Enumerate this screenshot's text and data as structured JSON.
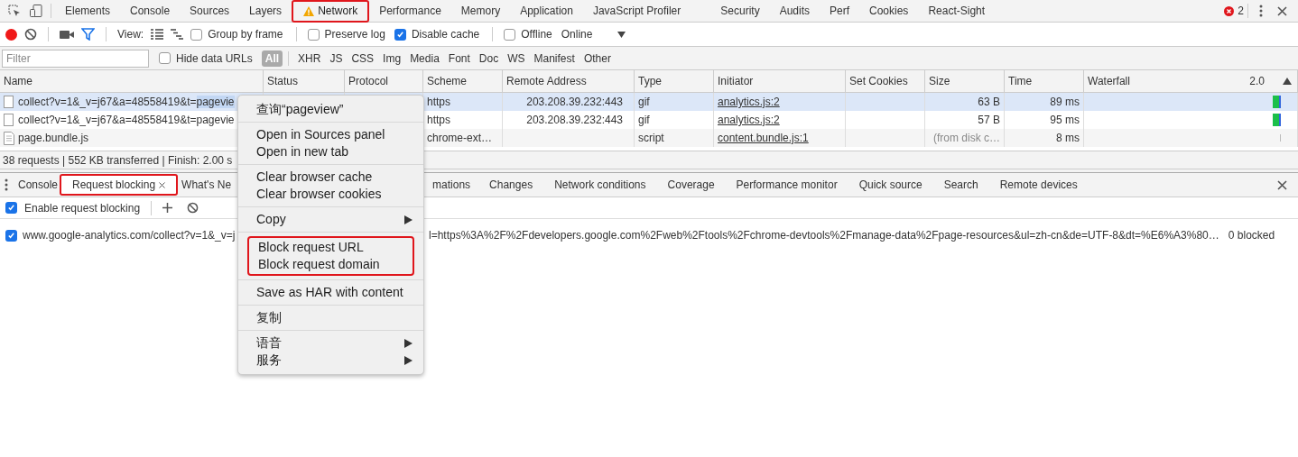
{
  "panel_tabs": [
    {
      "label": "Elements",
      "selected": false,
      "highlighted": false,
      "warning": false
    },
    {
      "label": "Console",
      "selected": false,
      "highlighted": false,
      "warning": false
    },
    {
      "label": "Sources",
      "selected": false,
      "highlighted": false,
      "warning": false
    },
    {
      "label": "Layers",
      "selected": false,
      "highlighted": false,
      "warning": false
    },
    {
      "label": "Network",
      "selected": true,
      "highlighted": true,
      "warning": true
    },
    {
      "label": "Performance",
      "selected": false,
      "highlighted": false,
      "warning": false
    },
    {
      "label": "Memory",
      "selected": false,
      "highlighted": false,
      "warning": false
    },
    {
      "label": "Application",
      "selected": false,
      "highlighted": false,
      "warning": false
    },
    {
      "label": "JavaScript Profiler",
      "selected": false,
      "highlighted": false,
      "warning": false
    },
    {
      "label": "Security",
      "selected": false,
      "highlighted": false,
      "warning": false
    },
    {
      "label": "Audits",
      "selected": false,
      "highlighted": false,
      "warning": false
    },
    {
      "label": "Perf",
      "selected": false,
      "highlighted": false,
      "warning": false
    },
    {
      "label": "Cookies",
      "selected": false,
      "highlighted": false,
      "warning": false
    },
    {
      "label": "React-Sight",
      "selected": false,
      "highlighted": false,
      "warning": false
    }
  ],
  "error_count": "2",
  "toolbar": {
    "recording": true,
    "filter_active": true,
    "view_label": "View:",
    "options": [
      {
        "label": "Group by frame",
        "checked": false
      },
      {
        "label": "Preserve log",
        "checked": false
      },
      {
        "label": "Disable cache",
        "checked": true
      },
      {
        "label": "Offline",
        "checked": false
      }
    ],
    "throttling": "Online"
  },
  "filter_bar": {
    "placeholder": "Filter",
    "hide_data_urls": {
      "label": "Hide data URLs",
      "checked": false
    },
    "types": [
      {
        "label": "All",
        "selected": true
      },
      {
        "label": "XHR",
        "selected": false
      },
      {
        "label": "JS",
        "selected": false
      },
      {
        "label": "CSS",
        "selected": false
      },
      {
        "label": "Img",
        "selected": false
      },
      {
        "label": "Media",
        "selected": false
      },
      {
        "label": "Font",
        "selected": false
      },
      {
        "label": "Doc",
        "selected": false
      },
      {
        "label": "WS",
        "selected": false
      },
      {
        "label": "Manifest",
        "selected": false
      },
      {
        "label": "Other",
        "selected": false
      }
    ]
  },
  "table": {
    "columns": [
      "Name",
      "Status",
      "Protocol",
      "Scheme",
      "Remote Address",
      "Type",
      "Initiator",
      "Set Cookies",
      "Size",
      "Time",
      "Waterfall"
    ],
    "waterfall_scale": "2.0",
    "rows": [
      {
        "kind": "image",
        "name": "collect?v=1&_v=j67&a=48558419&t=",
        "name_selection": "pagevie",
        "scheme": "https",
        "remote_address": "203.208.39.232:443",
        "type": "gif",
        "initiator": "analytics.js:2",
        "size": "63 B",
        "size_muted": false,
        "time": "89 ms",
        "selected": true
      },
      {
        "kind": "image",
        "name": "collect?v=1&_v=j67&a=48558419&t=pagevie",
        "name_selection": "",
        "scheme": "https",
        "remote_address": "203.208.39.232:443",
        "type": "gif",
        "initiator": "analytics.js:2",
        "size": "57 B",
        "size_muted": false,
        "time": "95 ms",
        "selected": false
      },
      {
        "kind": "script",
        "name": "page.bundle.js",
        "name_selection": "",
        "scheme": "chrome-ext…",
        "remote_address": "",
        "type": "script",
        "initiator": "content.bundle.js:1",
        "size": "(from disk c…",
        "size_muted": true,
        "time": "8 ms",
        "selected": false
      }
    ]
  },
  "summary": "38 requests | 552 KB transferred | Finish: 2.00 s",
  "drawer_tabs": [
    {
      "label": "Console",
      "selected": false,
      "highlighted": false,
      "closable": false
    },
    {
      "label": "Request blocking",
      "selected": true,
      "highlighted": true,
      "closable": true
    },
    {
      "label": "What's Ne",
      "selected": false,
      "highlighted": false,
      "closable": false
    },
    {
      "label": "mations",
      "selected": false,
      "highlighted": false,
      "closable": false
    },
    {
      "label": "Changes",
      "selected": false,
      "highlighted": false,
      "closable": false
    },
    {
      "label": "Network conditions",
      "selected": false,
      "highlighted": false,
      "closable": false
    },
    {
      "label": "Coverage",
      "selected": false,
      "highlighted": false,
      "closable": false
    },
    {
      "label": "Performance monitor",
      "selected": false,
      "highlighted": false,
      "closable": false
    },
    {
      "label": "Quick source",
      "selected": false,
      "highlighted": false,
      "closable": false
    },
    {
      "label": "Search",
      "selected": false,
      "highlighted": false,
      "closable": false
    },
    {
      "label": "Remote devices",
      "selected": false,
      "highlighted": false,
      "closable": false
    }
  ],
  "request_blocking": {
    "enable": {
      "label": "Enable request blocking",
      "checked": true
    },
    "patterns": [
      {
        "checked": true,
        "url_start": "www.google-analytics.com/collect?v=1&_v=j",
        "url_end": "l=https%3A%2F%2Fdevelopers.google.com%2Fweb%2Ftools%2Fchrome-devtools%2Fmanage-data%2Fpage-resources&ul=zh-cn&de=UTF-8&dt=%E6%A3%80…",
        "count": "0 blocked"
      }
    ]
  },
  "context_menu": {
    "groups": [
      {
        "highlighted": false,
        "items": [
          {
            "label": "查询“pageview”",
            "has_submenu": false
          }
        ]
      },
      {
        "highlighted": false,
        "items": [
          {
            "label": "Open in Sources panel",
            "has_submenu": false
          },
          {
            "label": "Open in new tab",
            "has_submenu": false
          }
        ]
      },
      {
        "highlighted": false,
        "items": [
          {
            "label": "Clear browser cache",
            "has_submenu": false
          },
          {
            "label": "Clear browser cookies",
            "has_submenu": false
          }
        ]
      },
      {
        "highlighted": false,
        "items": [
          {
            "label": "Copy",
            "has_submenu": true
          }
        ]
      },
      {
        "highlighted": true,
        "items": [
          {
            "label": "Block request URL",
            "has_submenu": false
          },
          {
            "label": "Block request domain",
            "has_submenu": false
          }
        ]
      },
      {
        "highlighted": false,
        "items": [
          {
            "label": "Save as HAR with content",
            "has_submenu": false
          }
        ]
      },
      {
        "highlighted": false,
        "items": [
          {
            "label": "复制",
            "has_submenu": false
          }
        ]
      },
      {
        "highlighted": false,
        "items": [
          {
            "label": "语音",
            "has_submenu": true
          },
          {
            "label": "服务",
            "has_submenu": true
          }
        ]
      }
    ]
  }
}
